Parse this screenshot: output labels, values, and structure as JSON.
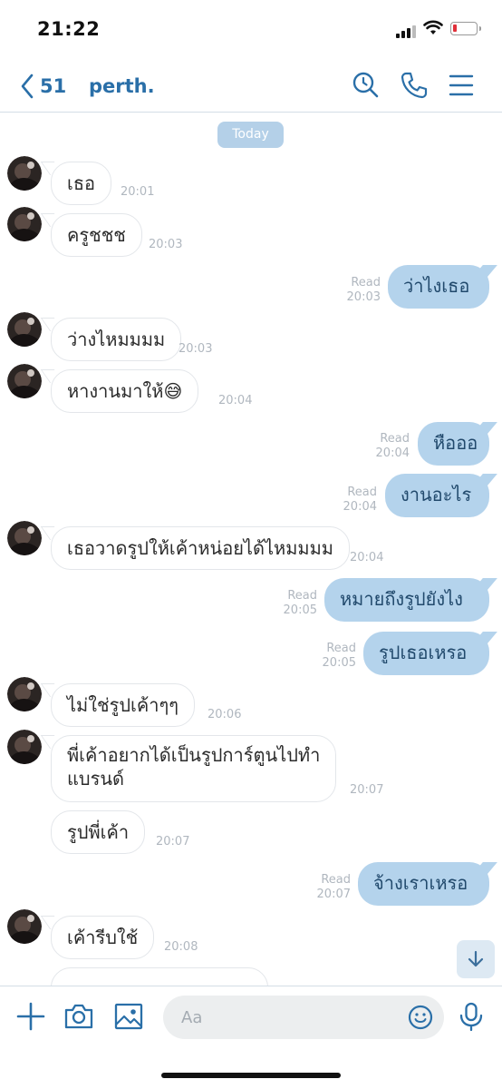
{
  "status_bar": {
    "time": "21:22"
  },
  "header": {
    "back_count": "51",
    "chat_name": "perth.",
    "icons": [
      "back-chevron-icon",
      "search-icon",
      "phone-icon",
      "menu-icon"
    ]
  },
  "chat": {
    "date_separator": "Today",
    "read_label": "Read",
    "messages": [
      {
        "dir": "in",
        "text": "เธอ",
        "time": "20:01"
      },
      {
        "dir": "in",
        "text": "ครูชชช",
        "time": "20:03"
      },
      {
        "dir": "out",
        "text": "ว่าไงเธอ",
        "time": "20:03",
        "read": true
      },
      {
        "dir": "in",
        "text": "ว่างไหมมมม",
        "time": "20:03"
      },
      {
        "dir": "in",
        "text": "หางานมาให้😅",
        "time": "20:04"
      },
      {
        "dir": "out",
        "text": "หือออ",
        "time": "20:04",
        "read": true
      },
      {
        "dir": "out",
        "text": "งานอะไร",
        "time": "20:04",
        "read": true
      },
      {
        "dir": "in",
        "text": "เธอวาดรูปให้เค้าหน่อยได้ไหมมมม",
        "time": "20:04"
      },
      {
        "dir": "out",
        "text": "หมายถึงรูปยังไง",
        "time": "20:05",
        "read": true
      },
      {
        "dir": "out",
        "text": "รูปเธอเหรอ",
        "time": "20:05",
        "read": true
      },
      {
        "dir": "in",
        "text": "ไม่ใช่รูปเค้าๆๆ",
        "time": "20:06"
      },
      {
        "dir": "in",
        "text_line1": "พี่เค้าอยากได้เป็นรูปการ์ตูนไปทำ",
        "text_line2": "แบรนด์",
        "time": "20:07"
      },
      {
        "dir": "in",
        "text": "รูปพี่เค้า",
        "time": "20:07"
      },
      {
        "dir": "out",
        "text": "จ้างเราเหรอ",
        "time": "20:07",
        "read": true
      },
      {
        "dir": "in",
        "text": "เค้ารีบใช้",
        "time": "20:08"
      }
    ]
  },
  "input_bar": {
    "placeholder": "Aa",
    "icons": [
      "plus-icon",
      "camera-icon",
      "image-icon",
      "emoji-icon",
      "microphone-icon"
    ]
  },
  "scroll_down_icon": "arrow-down-icon",
  "colors": {
    "accent": "#2a6fa8",
    "outgoing_bubble": "#b4d3ec",
    "date_badge": "#b4d0e8"
  }
}
